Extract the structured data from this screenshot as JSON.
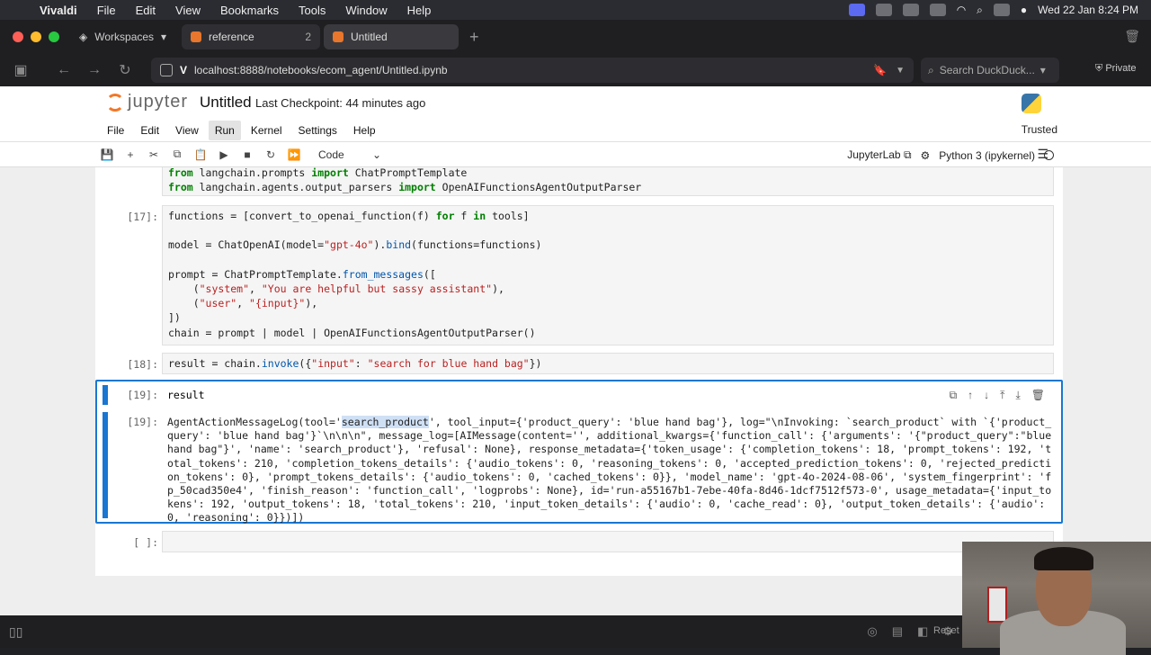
{
  "menubar": {
    "app": "Vivaldi",
    "items": [
      "File",
      "Edit",
      "View",
      "Bookmarks",
      "Tools",
      "Window",
      "Help"
    ],
    "datetime": "Wed 22 Jan  8:24 PM"
  },
  "tabs": {
    "workspaces": "Workspaces",
    "items": [
      {
        "label": "reference",
        "count": "2"
      },
      {
        "label": "Untitled"
      }
    ]
  },
  "address": {
    "url": "localhost:8888/notebooks/ecom_agent/Untitled.ipynb",
    "search_placeholder": "Search DuckDuck...",
    "private": "Private"
  },
  "jupyter": {
    "logo": "jupyter",
    "title": "Untitled",
    "checkpoint": "Last Checkpoint: 44 minutes ago",
    "menu": [
      "File",
      "Edit",
      "View",
      "Run",
      "Kernel",
      "Settings",
      "Help"
    ],
    "trusted": "Trusted",
    "cell_type": "Code",
    "jupyterlab": "JupyterLab",
    "kernel": "Python 3 (ipykernel)"
  },
  "cells": {
    "c0": {
      "lines": [
        "from langchain.prompts import ChatPromptTemplate",
        "from langchain.agents.output_parsers import OpenAIFunctionsAgentOutputParser"
      ]
    },
    "c17": {
      "prompt": "[17]:",
      "lines": [
        "functions = [convert_to_openai_function(f) for f in tools]",
        "",
        "model = ChatOpenAI(model=\"gpt-4o\").bind(functions=functions)",
        "",
        "prompt = ChatPromptTemplate.from_messages([",
        "    (\"system\", \"You are helpful but sassy assistant\"),",
        "    (\"user\", \"{input}\"),",
        "])",
        "chain = prompt | model | OpenAIFunctionsAgentOutputParser()"
      ]
    },
    "c18": {
      "prompt": "[18]:",
      "code": "result = chain.invoke({\"input\": \"search for blue hand bag\"})"
    },
    "c19": {
      "prompt": "[19]:",
      "code": "result",
      "out_prompt": "[19]:",
      "out_pre": "AgentActionMessageLog(tool='",
      "out_hl": "search_product",
      "out_post": "', tool_input={'product_query': 'blue hand bag'}, log=\"\\nInvoking: `search_product` with `{'product_query': 'blue hand bag'}`\\n\\n\\n\", message_log=[AIMessage(content='', additional_kwargs={'function_call': {'arguments': '{\"product_query\":\"blue hand bag\"}', 'name': 'search_product'}, 'refusal': None}, response_metadata={'token_usage': {'completion_tokens': 18, 'prompt_tokens': 192, 'total_tokens': 210, 'completion_tokens_details': {'audio_tokens': 0, 'reasoning_tokens': 0, 'accepted_prediction_tokens': 0, 'rejected_prediction_tokens': 0}, 'prompt_tokens_details': {'audio_tokens': 0, 'cached_tokens': 0}}, 'model_name': 'gpt-4o-2024-08-06', 'system_fingerprint': 'fp_50cad350e4', 'finish_reason': 'function_call', 'logprobs': None}, id='run-a55167b1-7ebe-40fa-8d46-1dcf7512f573-0', usage_metadata={'input_tokens': 192, 'output_tokens': 18, 'total_tokens': 210, 'input_token_details': {'audio': 0, 'cache_read': 0}, 'output_token_details': {'audio': 0, 'reasoning': 0}})])"
    },
    "empty": {
      "prompt": "[ ]:"
    }
  },
  "bottom": {
    "reset": "Reset"
  }
}
